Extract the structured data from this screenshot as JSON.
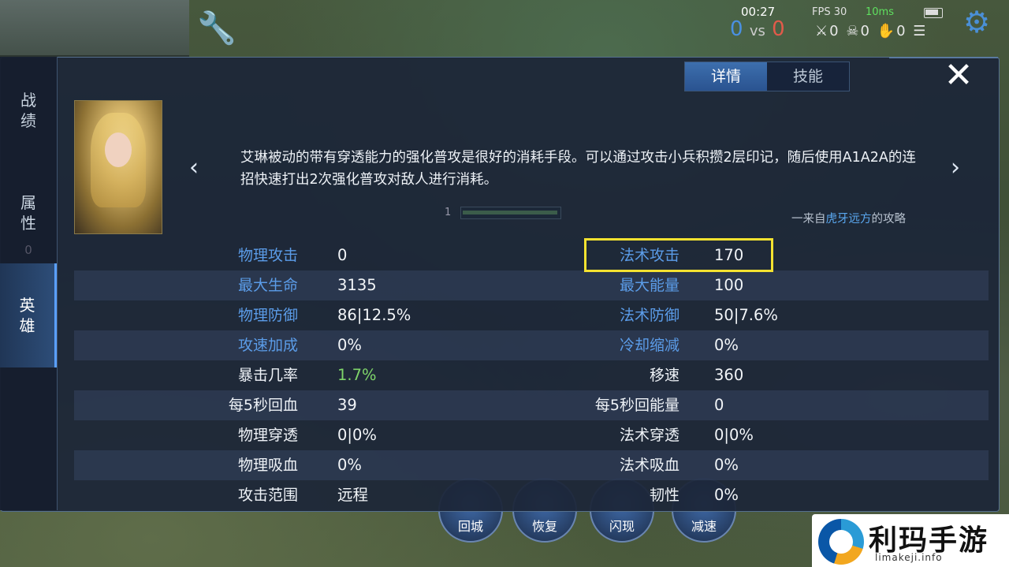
{
  "hud": {
    "time": "00:27",
    "fps": "FPS 30",
    "ping": "10ms",
    "score_blue": "0",
    "vs": "vs",
    "score_red": "0",
    "kills": "0",
    "deaths": "0",
    "assists": "0"
  },
  "sidebar": {
    "items": [
      {
        "label": "战\n绩"
      },
      {
        "label": "属\n性"
      },
      {
        "label": "英\n雄"
      }
    ],
    "zero": "0"
  },
  "tabs": {
    "details": "详情",
    "skills": "技能"
  },
  "close_symbol": "✕",
  "nav": {
    "prev": "‹",
    "next": "›"
  },
  "tip": {
    "text": "艾琳被动的带有穿透能力的强化普攻是很好的消耗手段。可以通过攻击小兵积攒2层印记，随后使用A1A2A的连招快速打出2次强化普攻对敌人进行消耗。",
    "page": "1",
    "source_prefix": "一来自",
    "source_author": "虎牙远方",
    "source_suffix": "的攻略"
  },
  "stats": [
    {
      "l_label": "物理攻击",
      "l_val": "0",
      "r_label": "法术攻击",
      "r_val": "170"
    },
    {
      "l_label": "最大生命",
      "l_val": "3135",
      "r_label": "最大能量",
      "r_val": "100"
    },
    {
      "l_label": "物理防御",
      "l_val": "86|12.5%",
      "r_label": "法术防御",
      "r_val": "50|7.6%"
    },
    {
      "l_label": "攻速加成",
      "l_val": "0%",
      "r_label": "冷却缩减",
      "r_val": "0%"
    },
    {
      "l_label": "暴击几率",
      "l_val": "1.7%",
      "r_label": "移速",
      "r_val": "360"
    },
    {
      "l_label": "每5秒回血",
      "l_val": "39",
      "r_label": "每5秒回能量",
      "r_val": "0"
    },
    {
      "l_label": "物理穿透",
      "l_val": "0|0%",
      "r_label": "法术穿透",
      "r_val": "0|0%"
    },
    {
      "l_label": "物理吸血",
      "l_val": "0%",
      "r_label": "法术吸血",
      "r_val": "0%"
    },
    {
      "l_label": "攻击范围",
      "l_val": "远程",
      "r_label": "韧性",
      "r_val": "0%"
    }
  ],
  "skills_bar": [
    "回城",
    "恢复",
    "闪现",
    "减速"
  ],
  "watermark": {
    "name": "利玛手游",
    "url": "limakeji.info"
  },
  "colors": {
    "label_blue": "#5b9ce8",
    "crit_green": "#7fd56a",
    "highlight_yellow": "#f4e230"
  }
}
